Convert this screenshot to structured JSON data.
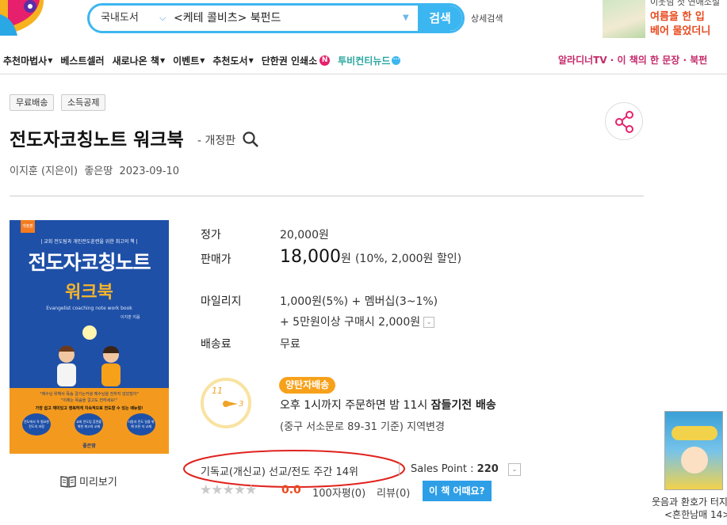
{
  "header": {
    "search": {
      "scope": "국내도서",
      "query": "<케테 콜비츠> 북펀드",
      "button": "검색"
    },
    "advanced_search": "상세검색",
    "ad": {
      "line1": "이웃님 첫 연애소설",
      "line2": "여름을 한 입",
      "line3": "베어 물었더니"
    }
  },
  "nav": {
    "items": [
      "추천마법사",
      "베스트셀러",
      "새로나온 책",
      "이벤트",
      "추천도서",
      "단한권 인쇄소",
      "투비컨티뉴드"
    ],
    "right": "알라디너TV · 이 책의 한 문장 · 북펀"
  },
  "product": {
    "badges": [
      "무료배송",
      "소득공제"
    ],
    "title": "전도자코칭노트 워크북",
    "edition": "- 개정판",
    "author": "이지훈 (지은이)",
    "publisher": "좋은땅",
    "date": "2023-09-10",
    "preview": "미리보기",
    "cover": {
      "tag": "개정판",
      "subtitle": "| 교회 전도팀과 개인전도훈련을 위한 최고의 책 |",
      "main": "전도자코칭노트",
      "sub": "워크북",
      "english": "Evangelist coaching note work book",
      "author": "이지훈 지음",
      "quote1": "\"예수님 위해서 목숨 걸기는커녕 예수님을 전하지 않았잖아\"",
      "quote2": "\"이제는 목숨을 걸고도 전하세요!\"",
      "tagline": "가장 쉽고 재미있고 행복하게 지속적으로 전도할 수 있는 매뉴얼!",
      "circles": [
        "전도에서 꼭 필요한 전도의 과정",
        "교회 전도팀 훈련을 위한 최고의 교재",
        "사람과 전도 일을 위해 부른 자 교재"
      ],
      "publisher": "좋은땅"
    }
  },
  "pricing": {
    "list_label": "정가",
    "list_value": "20,000원",
    "sale_label": "판매가",
    "sale_value": "18,000",
    "sale_unit": "원",
    "sale_note": "(10%, 2,000원 할인)",
    "mileage_label": "마일리지",
    "mileage_line1": "1,000원(5%) + 멤버십(3~1%)",
    "mileage_line2": "+ 5만원이상 구매시 2,000원",
    "shipping_label": "배송료",
    "shipping_value": "무료"
  },
  "delivery": {
    "badge": "양탄자배송",
    "line1_a": "오후 1시까지 주문하면 밤 11시 ",
    "line1_b": "잠들기전 배송",
    "line2": "(중구 서소문로 89-31 기준) 지역변경",
    "clock_numbers": [
      "11",
      "3"
    ]
  },
  "stats": {
    "rank": "기독교(개신교) 선교/전도 주간 14위",
    "sales_label": "Sales Point : ",
    "sales_value": "220",
    "rating": "0.0",
    "reviews100": "100자평(0)",
    "reviews": "리뷰(0)",
    "how_button": "이 책 어때요?"
  },
  "side_banner": {
    "caption1": "웃음과 환호가 터지",
    "caption2": "<흔한남매 14>"
  },
  "colors": {
    "accent": "#3cb6f0",
    "badge_orange": "#f7a11a",
    "annotation_red": "#e0231e",
    "rating_red": "#e8491d"
  }
}
